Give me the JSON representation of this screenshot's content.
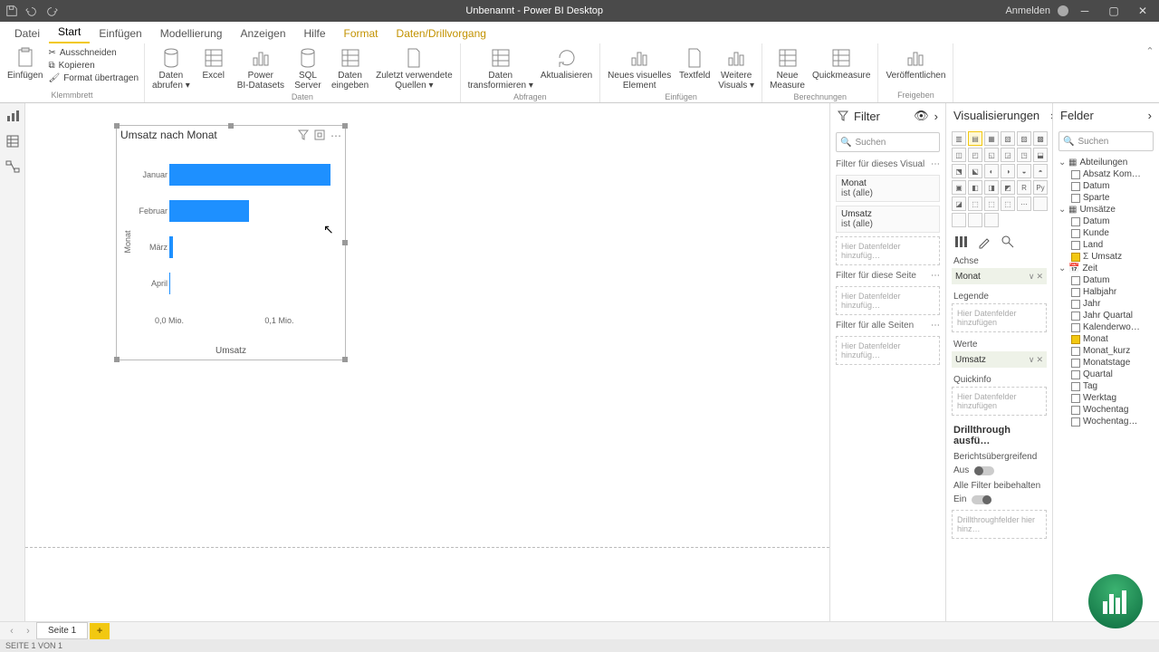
{
  "title": "Unbenannt - Power BI Desktop",
  "signin": "Anmelden",
  "tabs": {
    "file": "Datei",
    "start": "Start",
    "insert": "Einfügen",
    "model": "Modellierung",
    "view": "Anzeigen",
    "help": "Hilfe",
    "format": "Format",
    "drill": "Daten/Drillvorgang"
  },
  "ribbon": {
    "clipboard": {
      "paste": "Einfügen",
      "cut": "Ausschneiden",
      "copy": "Kopieren",
      "painter": "Format übertragen",
      "label": "Klemmbrett"
    },
    "data": {
      "get": "Daten\nabrufen ▾",
      "excel": "Excel",
      "pbids": "Power\nBI-Datasets",
      "sql": "SQL\nServer",
      "enter": "Daten\neingeben",
      "recent": "Zuletzt verwendete\nQuellen ▾",
      "label": "Daten"
    },
    "queries": {
      "transform": "Daten\ntransformieren ▾",
      "refresh": "Aktualisieren",
      "label": "Abfragen"
    },
    "insert": {
      "newvis": "Neues visuelles\nElement",
      "text": "Textfeld",
      "more": "Weitere\nVisuals ▾",
      "label": "Einfügen"
    },
    "calc": {
      "measure": "Neue\nMeasure",
      "quick": "Quickmeasure",
      "label": "Berechnungen"
    },
    "share": {
      "publish": "Veröffentlichen",
      "label": "Freigeben"
    }
  },
  "chart_data": {
    "type": "bar",
    "title": "Umsatz nach Monat",
    "categories": [
      "Januar",
      "Februar",
      "März",
      "April"
    ],
    "values": [
      0.145,
      0.072,
      0.003,
      0.001
    ],
    "xlabel": "Umsatz",
    "ylabel": "Monat",
    "xticks": [
      "0,0 Mio.",
      "0,1 Mio."
    ],
    "xmax": 0.15
  },
  "filter": {
    "title": "Filter",
    "search": "Suchen",
    "sec_visual": "Filter für dieses Visual",
    "monat": "Monat",
    "monat_v": "ist (alle)",
    "umsatz": "Umsatz",
    "umsatz_v": "ist (alle)",
    "drop": "Hier Datenfelder hinzufüg…",
    "sec_page": "Filter für diese Seite",
    "sec_all": "Filter für alle Seiten"
  },
  "viz": {
    "title": "Visualisierungen",
    "axis": "Achse",
    "axis_v": "Monat",
    "legend": "Legende",
    "legend_drop": "Hier Datenfelder hinzufügen",
    "values": "Werte",
    "values_v": "Umsatz",
    "tooltip": "Quickinfo",
    "tooltip_drop": "Hier Datenfelder hinzufügen",
    "drill_t": "Drillthrough ausfü…",
    "cross": "Berichtsübergreifend",
    "off": "Aus",
    "keep": "Alle Filter beibehalten",
    "on": "Ein",
    "drill_drop": "Drillthroughfelder hier hinz…"
  },
  "fields": {
    "title": "Felder",
    "search": "Suchen",
    "tables": [
      {
        "name": "Abteilungen",
        "cols": [
          {
            "n": "Absatz Kom…"
          },
          {
            "n": "Datum"
          },
          {
            "n": "Sparte"
          }
        ]
      },
      {
        "name": "Umsätze",
        "cols": [
          {
            "n": "Datum"
          },
          {
            "n": "Kunde"
          },
          {
            "n": "Land"
          },
          {
            "n": "Umsatz",
            "ck": true,
            "sigma": true
          }
        ]
      },
      {
        "name": "Zeit",
        "cal": true,
        "cols": [
          {
            "n": "Datum"
          },
          {
            "n": "Halbjahr"
          },
          {
            "n": "Jahr"
          },
          {
            "n": "Jahr Quartal"
          },
          {
            "n": "Kalenderwo…"
          },
          {
            "n": "Monat",
            "ck": true
          },
          {
            "n": "Monat_kurz"
          },
          {
            "n": "Monatstage"
          },
          {
            "n": "Quartal"
          },
          {
            "n": "Tag"
          },
          {
            "n": "Werktag"
          },
          {
            "n": "Wochentag"
          },
          {
            "n": "Wochentag…"
          }
        ]
      }
    ]
  },
  "page": {
    "tab": "Seite 1",
    "status": "SEITE 1 VON 1"
  }
}
